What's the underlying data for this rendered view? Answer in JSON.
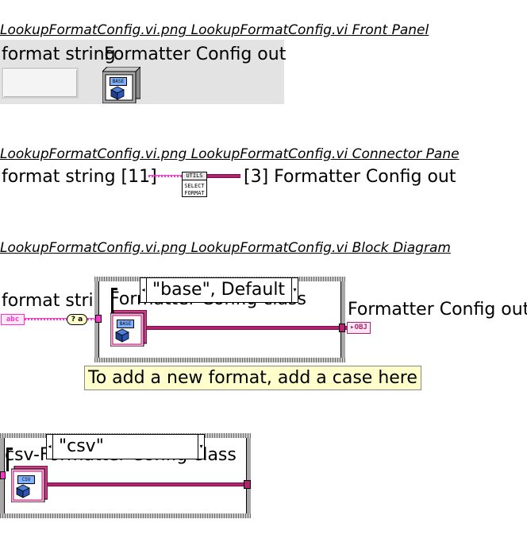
{
  "sections": {
    "front_panel_heading": "LookupFormatConfig.vi.png  LookupFormatConfig.vi Front Panel",
    "connector_pane_heading": "LookupFormatConfig.vi.png  LookupFormatConfig.vi Connector Pane",
    "block_diagram_heading": "LookupFormatConfig.vi.png  LookupFormatConfig.vi Block Diagram"
  },
  "front_panel": {
    "format_string_label": "format string",
    "formatter_config_out_label": "Formatter Config out",
    "class_icon_text": "BASE"
  },
  "connector_pane": {
    "left_label": "format string [11]",
    "right_label": "[3] Formatter Config out",
    "subvi_icon_line1": "UTILS",
    "subvi_icon_line2": "SELECT",
    "subvi_icon_line3": "FORMAT"
  },
  "block_diagram": {
    "format_string_label": "format string",
    "formatter_config_out_label": "Formatter Config out",
    "string_terminal_text": "abc",
    "case_selector_text": "\"base\", Default",
    "case_inner_label": "Formatter Config class",
    "base_icon_text": "BASE",
    "out_terminal_text": "OBJ",
    "comment_text": "To add a new format, add a case here",
    "compare_node_text": "? a"
  },
  "csv_case": {
    "case_selector_text": "\"csv\"",
    "case_inner_label": "csv-Formatter Config class",
    "csv_icon_text": "CSV"
  },
  "colors": {
    "class_wire": "#b0236f",
    "string_wire": "#ff33cc",
    "panel_bg": "#e3e3e3",
    "comment_bg": "#ffffcc",
    "icon_tab": "#7fb0ff"
  }
}
